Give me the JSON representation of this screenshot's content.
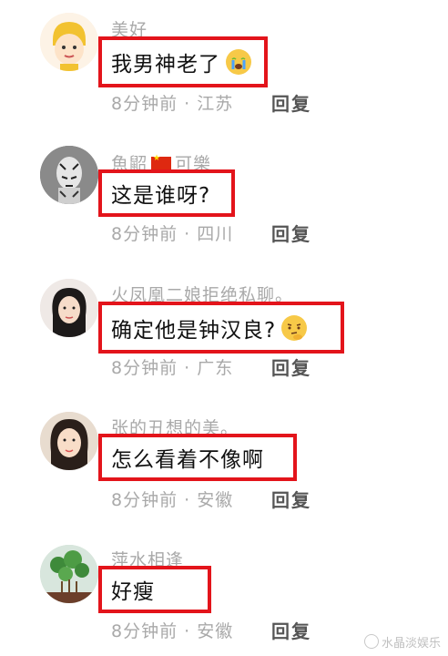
{
  "comments": [
    {
      "username": "美好",
      "text": "我男神老了",
      "emoji": "crying-face-icon",
      "time": "8分钟前",
      "location": "江苏",
      "reply": "回复"
    },
    {
      "username": "可樂",
      "username_prefix": "魚鼦",
      "text": "这是谁呀?",
      "time": "8分钟前",
      "location": "四川",
      "reply": "回复"
    },
    {
      "username": "火凤凰二娘拒绝私聊。",
      "text": "确定他是钟汉良?",
      "emoji": "thinking-face-icon",
      "time": "8分钟前",
      "location": "广东",
      "reply": "回复"
    },
    {
      "username": "张的丑想的美。",
      "text": "怎么看着不像啊",
      "time": "8分钟前",
      "location": "安徽",
      "reply": "回复"
    },
    {
      "username": "萍水相逢",
      "text": "好瘦",
      "time": "8分钟前",
      "location": "安徽",
      "reply": "回复"
    }
  ],
  "separator": "·",
  "watermark": "水晶淡娱乐",
  "colors": {
    "highlight_border": "#e3141b",
    "muted_text": "#a9a9a9",
    "reply_text": "#555555"
  }
}
